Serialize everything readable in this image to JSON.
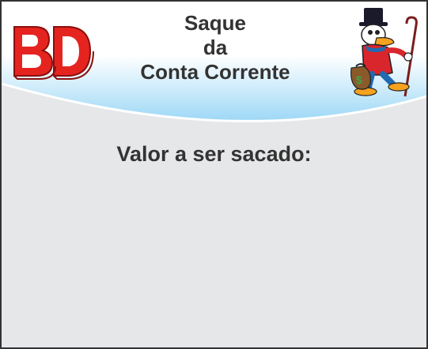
{
  "header": {
    "logo_text": "BD",
    "title_lines": [
      "Saque",
      "da",
      "Conta Corrente"
    ]
  },
  "main": {
    "prompt": "Valor a ser sacado:"
  },
  "icons": {
    "logo": "bd-logo",
    "mascot": "duck-mascot-icon",
    "money_bag": "money-bag-icon"
  },
  "colors": {
    "header_top": "#ffffff",
    "header_bottom": "#9dd8f6",
    "body_background": "#e6e7e9",
    "logo_red": "#e52420",
    "text": "#333333"
  }
}
